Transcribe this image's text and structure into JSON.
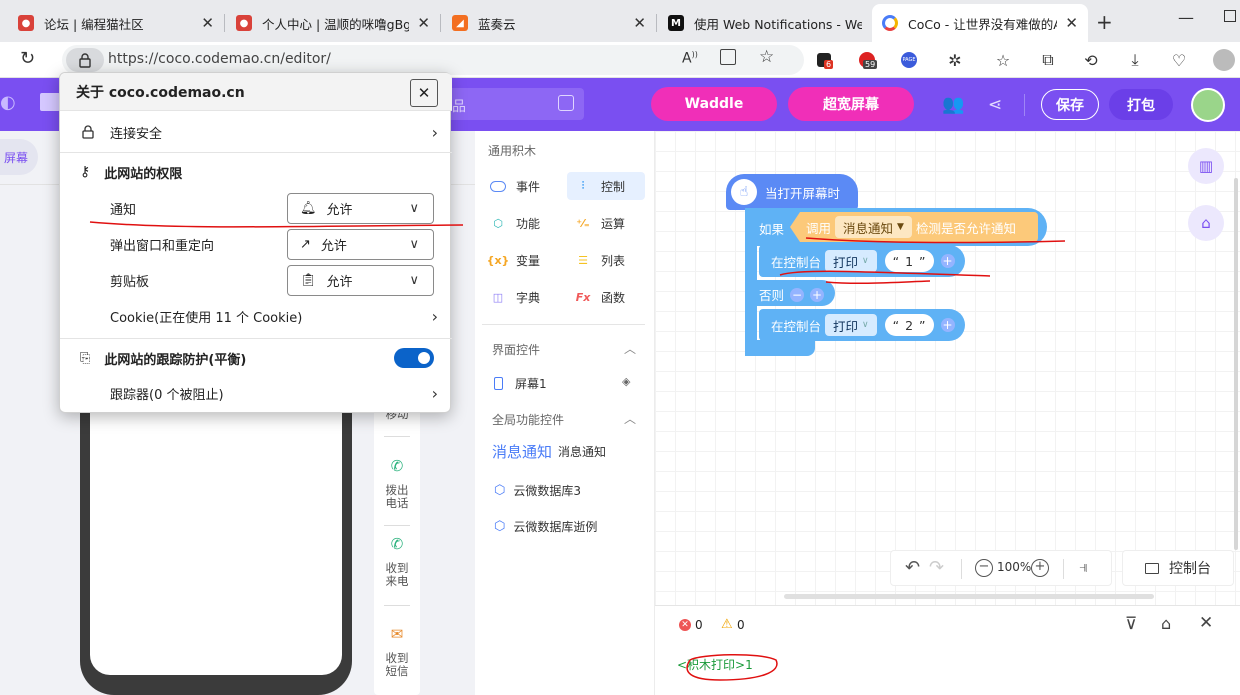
{
  "tabs": [
    {
      "title": "论坛 | 编程猫社区",
      "favicon_color": "#d9423a",
      "favicon": "cat-logo-icon"
    },
    {
      "title": "个人中心 | 温顺的咪噜gBgE",
      "favicon_color": "#d9423a",
      "favicon": "cat-logo-icon"
    },
    {
      "title": "蓝奏云",
      "favicon_color": "#f36f21",
      "favicon": "lanzou-logo-icon"
    },
    {
      "title": "使用 Web Notifications - We",
      "favicon_color": "#111111",
      "favicon": "mdn-logo-icon"
    },
    {
      "title": "CoCo - 让世界没有难做的AP",
      "favicon_color": "#4a7cf7",
      "favicon": "coco-logo-icon",
      "active": true
    }
  ],
  "address": {
    "url": "https://coco.codemao.cn/editor/",
    "ext_badge_1": "6",
    "ext_badge_2": "59",
    "ext_label_3": "PAGE"
  },
  "app_header": {
    "works_text": "品",
    "waddle_label": "Waddle",
    "wide_screen_label": "超宽屏幕",
    "save_label": "保存",
    "pack_label": "打包",
    "accent_color": "#7a4ff1",
    "pink_color": "#f02fb8"
  },
  "left": {
    "screen_tab": "屏幕",
    "move_label": "移动",
    "tools": [
      {
        "label": "拨出电话",
        "icon": "phone-out-icon"
      },
      {
        "label": "收到来电",
        "icon": "phone-in-icon"
      },
      {
        "label": "收到短信",
        "icon": "sms-icon"
      }
    ]
  },
  "palette": {
    "common_title": "通用积木",
    "items": [
      {
        "label": "事件",
        "icon": "event-icon",
        "color": "#5b8af5"
      },
      {
        "label": "控制",
        "icon": "control-icon",
        "color": "#4aa4f5",
        "active": true
      },
      {
        "label": "功能",
        "icon": "function-icon",
        "color": "#2ab6b4"
      },
      {
        "label": "运算",
        "icon": "operator-icon",
        "color": "#f5a623"
      },
      {
        "label": "变量",
        "icon": "variable-icon",
        "color": "#f5a623"
      },
      {
        "label": "列表",
        "icon": "list-icon",
        "color": "#f5c323"
      },
      {
        "label": "字典",
        "icon": "dict-icon",
        "color": "#8c7cf5"
      },
      {
        "label": "函数",
        "icon": "fx-icon",
        "color": "#f05a5a"
      }
    ],
    "ui_controls_title": "界面控件",
    "screen_item": "屏幕1",
    "global_controls_title": "全局功能控件",
    "global_items": [
      {
        "label": "消息通知",
        "alt": "消息通知"
      },
      {
        "label": "云微数据库3"
      },
      {
        "label": "云微数据库逝例"
      }
    ]
  },
  "workspace": {
    "event_block": "当打开屏幕时",
    "if_label": "如果",
    "call_label": "调用",
    "notify_dropdown": "消息通知",
    "check_label": "检测是否允许通知",
    "print_block_1": {
      "prefix": "在控制台",
      "action": "打印",
      "value": "1"
    },
    "else_label": "否则",
    "print_block_2": {
      "prefix": "在控制台",
      "action": "打印",
      "value": "2"
    },
    "zoom": "100%",
    "console_button": "控制台"
  },
  "console": {
    "errors": "0",
    "warnings": "0",
    "output": "<积木打印>1"
  },
  "popup": {
    "title": "关于 coco.codemao.cn",
    "connection": "连接安全",
    "permissions_title": "此网站的权限",
    "notifications_label": "通知",
    "notifications_value": "允许",
    "popups_label": "弹出窗口和重定向",
    "popups_value": "允许",
    "clipboard_label": "剪贴板",
    "clipboard_value": "允许",
    "cookies": "Cookie(正在使用 11 个 Cookie)",
    "tracking_title": "此网站的跟踪防护(平衡)",
    "trackers": "跟踪器(0 个被阻止)",
    "tracking_enabled": true
  }
}
